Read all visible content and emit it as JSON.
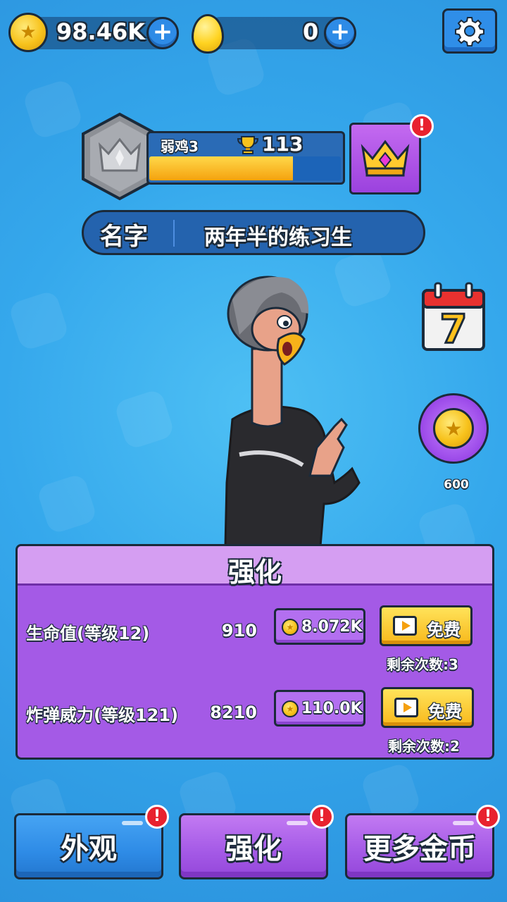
{
  "currency": {
    "coins": "98.46K",
    "eggs": "0"
  },
  "rank": {
    "name": "弱鸡3",
    "trophies": "113",
    "progress": 0.75
  },
  "player": {
    "name_label": "名字",
    "name_value": "两年半的练习生"
  },
  "side": {
    "calendar_day": "7",
    "coin_reward": "600"
  },
  "upgrade_panel": {
    "title": "强化",
    "rows": [
      {
        "label": "生命值(等级12)",
        "value": "910",
        "cost": "8.072K",
        "free_label": "免费",
        "remaining": "剩余次数:3"
      },
      {
        "label": "炸弹威力(等级121)",
        "value": "8210",
        "cost": "110.0K",
        "free_label": "免费",
        "remaining": "剩余次数:2"
      }
    ]
  },
  "nav": {
    "appearance": "外观",
    "upgrade": "强化",
    "more_coins": "更多金币"
  },
  "icons": {
    "alert": "!",
    "settings": "gear-icon",
    "crown": "crown-icon",
    "video": "video-icon",
    "coin": "coin-icon"
  },
  "colors": {
    "background": "#35a8ec",
    "panel": "#a45ae6",
    "accent_gold": "#f7c21c",
    "alert_red": "#e8222e"
  }
}
